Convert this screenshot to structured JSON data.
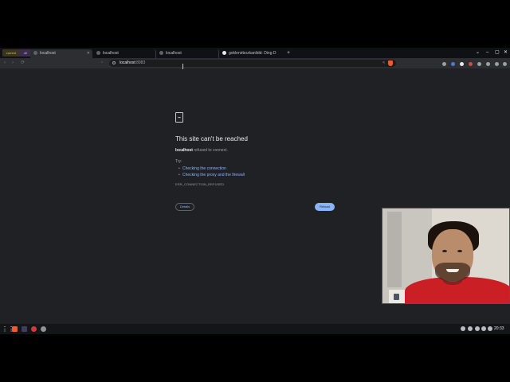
{
  "tabs": {
    "workspace_1": "current",
    "workspace_2": "dtl",
    "items": [
      {
        "title": "localhost"
      },
      {
        "title": "localhost"
      },
      {
        "title": "localhost"
      },
      {
        "title": "goklenirbozkanlidd: Ding D"
      }
    ],
    "new_tab": "+",
    "window_controls": [
      "⌄",
      "–",
      "▢",
      "✕"
    ]
  },
  "toolbar": {
    "back": "‹",
    "forward": "›",
    "reload": "⟳",
    "url_host": "localhost",
    "url_port": ":8983",
    "share_icon": "share-icon",
    "shield_icon": "brave-shield-icon"
  },
  "error_page": {
    "icon": "sad-document-icon",
    "title": "This site can't be reached",
    "message_host": "localhost",
    "message_rest": " refused to connect.",
    "try_label": "Try:",
    "suggestions": [
      "Checking the connection",
      "Checking the proxy and the firewall"
    ],
    "error_code": "ERR_CONNECTION_REFUSED",
    "details_button": "Details",
    "reload_button": "Reload"
  },
  "taskbar": {
    "clock": "20:33"
  },
  "colors": {
    "page_bg": "#202124",
    "accent": "#8ab4f8",
    "hoodie": "#c91f25"
  }
}
